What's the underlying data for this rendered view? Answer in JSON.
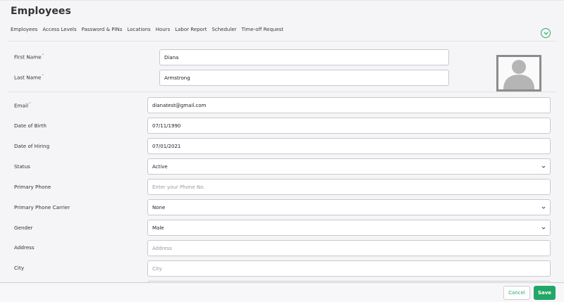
{
  "page": {
    "title": "Employees"
  },
  "tabs": [
    "Employees",
    "Access Levels",
    "Password & PINs",
    "Locations",
    "Hours",
    "Labor Report",
    "Scheduler",
    "Time-off Request"
  ],
  "form": {
    "first_name": {
      "label": "First Name",
      "required_mark": "*",
      "value": "Diana"
    },
    "last_name": {
      "label": "Last Name",
      "required_mark": "*",
      "value": "Armstrong"
    },
    "email": {
      "label": "Email",
      "required_mark": "*",
      "value": "dianatest@gmail.com"
    },
    "dob": {
      "label": "Date of Birth",
      "value": "07/11/1990"
    },
    "hiring": {
      "label": "Date of Hiring",
      "value": "07/01/2021"
    },
    "status": {
      "label": "Status",
      "value": "Active"
    },
    "phone": {
      "label": "Primary Phone",
      "value": "",
      "placeholder": "Enter your Phone No."
    },
    "carrier": {
      "label": "Primary Phone Carrier",
      "value": "None"
    },
    "gender": {
      "label": "Gender",
      "value": "Male"
    },
    "address": {
      "label": "Address",
      "value": "",
      "placeholder": "Address"
    },
    "city": {
      "label": "City",
      "value": "",
      "placeholder": "City"
    }
  },
  "footer": {
    "cancel_label": "Cancel",
    "save_label": "Save"
  },
  "icons": {
    "collapse": "chevron-down-circle-icon",
    "select": "chevron-down-icon",
    "avatar": "avatar-placeholder-icon"
  },
  "colors": {
    "accent": "#22a768",
    "border": "#c9c9ce",
    "background": "#f5f5f7"
  }
}
